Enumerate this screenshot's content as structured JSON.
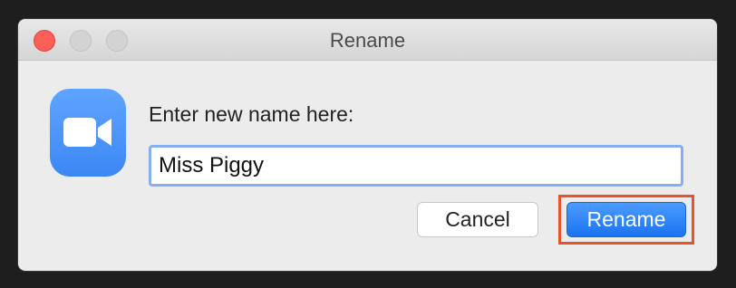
{
  "window": {
    "title": "Rename",
    "app_icon": "video-camera-icon"
  },
  "form": {
    "prompt": "Enter new name here:",
    "name_value": "Miss Piggy"
  },
  "buttons": {
    "cancel_label": "Cancel",
    "rename_label": "Rename"
  },
  "colors": {
    "primary_button": "#1a73f0",
    "highlight_box": "#e8542a",
    "close_button": "#fc5f58"
  }
}
